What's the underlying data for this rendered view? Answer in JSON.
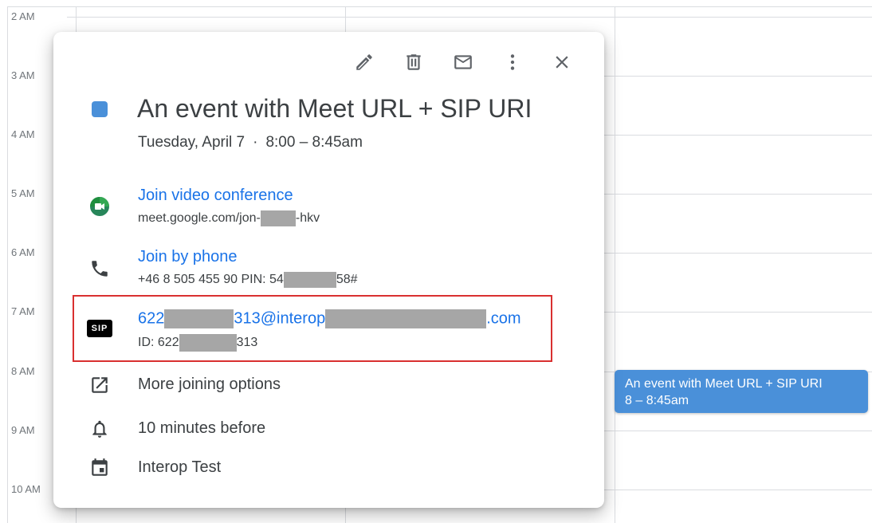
{
  "calendar": {
    "hours": [
      "2 AM",
      "3 AM",
      "4 AM",
      "5 AM",
      "6 AM",
      "7 AM",
      "8 AM",
      "9 AM",
      "10 AM"
    ],
    "event_chip": {
      "title": "An event with Meet URL + SIP URI",
      "time": "8 – 8:45am"
    }
  },
  "popup": {
    "toolbar": {
      "edit_icon": "pencil-icon",
      "delete_icon": "trash-icon",
      "email_icon": "envelope-icon",
      "more_icon": "more-vert-icon",
      "close_icon": "close-icon"
    },
    "event_color": "#4a90d9",
    "title": "An event with Meet URL + SIP URI",
    "date": "Tuesday, April 7",
    "separator": "·",
    "time": "8:00 – 8:45am",
    "video": {
      "link": "Join video conference",
      "url_prefix": "meet.google.com/jon-",
      "url_suffix": "-hkv"
    },
    "phone": {
      "link": "Join by phone",
      "number_prefix": "+46 8 505 455 90 PIN: 54",
      "number_suffix": "58#"
    },
    "sip": {
      "badge": "SIP",
      "uri_part1": "622",
      "uri_part2": "313@interop",
      "uri_part3": ".com",
      "id_prefix": "ID: 622",
      "id_suffix": "313"
    },
    "more_options": "More joining options",
    "reminder": "10 minutes before",
    "calendar_name": "Interop Test"
  }
}
